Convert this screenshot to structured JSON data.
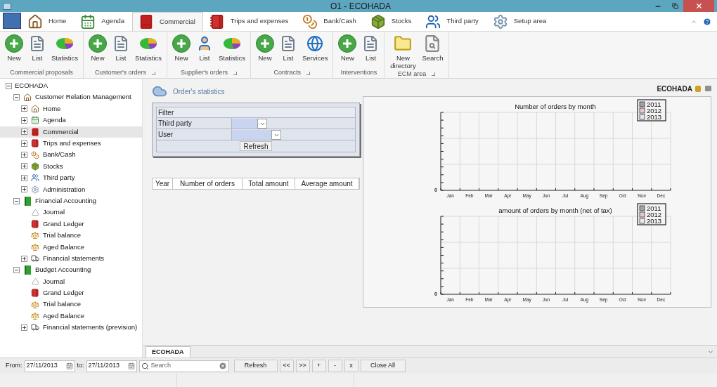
{
  "window": {
    "title": "O1 - ECOHADA"
  },
  "tabs": [
    {
      "label": "Home",
      "kind": "house",
      "selected": false
    },
    {
      "label": "Agenda",
      "kind": "calendar",
      "selected": false
    },
    {
      "label": "Commercial",
      "kind": "book",
      "selected": true
    },
    {
      "label": "Trips and expenses",
      "kind": "ledger",
      "selected": false
    },
    {
      "label": "Bank/Cash",
      "kind": "bag",
      "selected": false
    },
    {
      "label": "Stocks",
      "kind": "box",
      "selected": false
    },
    {
      "label": "Third party",
      "kind": "people",
      "selected": false
    },
    {
      "label": "Setup area",
      "kind": "gear",
      "selected": false
    }
  ],
  "ribbon_groups": [
    {
      "label": "Commercial proposals",
      "launcher": false,
      "buttons": [
        {
          "label": "New",
          "kind": "new"
        },
        {
          "label": "List",
          "kind": "list"
        },
        {
          "label": "Statistics",
          "kind": "stats"
        }
      ]
    },
    {
      "label": "Customer's orders",
      "launcher": true,
      "buttons": [
        {
          "label": "New",
          "kind": "new"
        },
        {
          "label": "List",
          "kind": "list"
        },
        {
          "label": "Statistics",
          "kind": "stats"
        }
      ]
    },
    {
      "label": "Supplier's orders",
      "launcher": true,
      "buttons": [
        {
          "label": "New",
          "kind": "new"
        },
        {
          "label": "List",
          "kind": "person"
        },
        {
          "label": "Statistics",
          "kind": "stats"
        }
      ]
    },
    {
      "label": "Contracts",
      "launcher": true,
      "buttons": [
        {
          "label": "New",
          "kind": "new"
        },
        {
          "label": "List",
          "kind": "list"
        },
        {
          "label": "Services",
          "kind": "globe"
        }
      ]
    },
    {
      "label": "Interventions",
      "launcher": false,
      "buttons": [
        {
          "label": "New",
          "kind": "new"
        },
        {
          "label": "List",
          "kind": "list"
        }
      ]
    },
    {
      "label": "ECM area",
      "launcher": true,
      "buttons": [
        {
          "label": "New directory",
          "kind": "folder"
        },
        {
          "label": "Search",
          "kind": "search"
        }
      ]
    }
  ],
  "sidebar": {
    "tree": [
      {
        "label": "ECOHADA",
        "expanded": true,
        "selected": false,
        "children": [
          {
            "label": "Customer Relation Management",
            "kind": "house",
            "expanded": true,
            "selected": false,
            "children": [
              {
                "label": "Home",
                "kind": "house",
                "expanded": false,
                "selected": false
              },
              {
                "label": "Agenda",
                "kind": "calendar",
                "expanded": false,
                "selected": false
              },
              {
                "label": "Commercial",
                "kind": "book",
                "expanded": false,
                "selected": true
              },
              {
                "label": "Trips and expenses",
                "kind": "ledger",
                "expanded": false,
                "selected": false
              },
              {
                "label": "Bank/Cash",
                "kind": "bag",
                "expanded": false,
                "selected": false
              },
              {
                "label": "Stocks",
                "kind": "box",
                "expanded": false,
                "selected": false
              },
              {
                "label": "Third party",
                "kind": "people",
                "expanded": false,
                "selected": false
              },
              {
                "label": "Administration",
                "kind": "gear",
                "expanded": false,
                "selected": false
              }
            ]
          },
          {
            "label": "Financial Accounting",
            "kind": "green",
            "expanded": true,
            "selected": false,
            "children": [
              {
                "label": "Journal",
                "kind": "triangle",
                "selected": false
              },
              {
                "label": "Grand Ledger",
                "kind": "ledger",
                "selected": false
              },
              {
                "label": "Trial balance",
                "kind": "scales",
                "selected": false
              },
              {
                "label": "Aged Balance",
                "kind": "scales",
                "selected": false
              },
              {
                "label": "Financial statements",
                "kind": "truck",
                "expanded": false,
                "selected": false
              }
            ]
          },
          {
            "label": "Budget Accounting",
            "kind": "green",
            "expanded": true,
            "selected": false,
            "children": [
              {
                "label": "Journal",
                "kind": "triangle",
                "selected": false
              },
              {
                "label": "Grand Ledger",
                "kind": "ledger",
                "selected": false
              },
              {
                "label": "Trial balance",
                "kind": "scales",
                "selected": false
              },
              {
                "label": "Aged Balance",
                "kind": "scales",
                "selected": false
              },
              {
                "label": "Financial statements (prevision)",
                "kind": "truck",
                "expanded": false,
                "selected": false
              }
            ]
          }
        ]
      }
    ]
  },
  "content": {
    "title": "Order's statistics",
    "company": "ECOHADA",
    "filter": {
      "heading": "Filter",
      "fields": [
        {
          "label": "Third party"
        },
        {
          "label": "User"
        }
      ],
      "button": "Refresh"
    },
    "table": {
      "columns": [
        "Year",
        "Number of orders",
        "Total amount",
        "Average amount"
      ]
    },
    "charts": [
      {
        "title": "Number of orders by month",
        "ytick": "0",
        "months": [
          "Jan",
          "Feb",
          "Mar",
          "Apr",
          "May",
          "Jun",
          "Jul",
          "Aug",
          "Sep",
          "Oct",
          "Nov",
          "Dec"
        ],
        "legend": [
          {
            "label": "2011",
            "color": "#a0a0a8"
          },
          {
            "label": "2012",
            "color": "#e8c8d0"
          },
          {
            "label": "2013",
            "color": "#e4e4f4"
          }
        ]
      },
      {
        "title": "amount of orders by month (net of tax)",
        "ytick": "0",
        "months": [
          "Jan",
          "Feb",
          "Mar",
          "Apr",
          "May",
          "Jun",
          "Jul",
          "Aug",
          "Sep",
          "Oct",
          "Nov",
          "Dec"
        ],
        "legend": [
          {
            "label": "2011",
            "color": "#a0a8a8"
          },
          {
            "label": "2012",
            "color": "#e8c8d0"
          },
          {
            "label": "2013",
            "color": "#e8e8f0"
          }
        ]
      }
    ]
  },
  "doc_tabs": [
    {
      "label": "ECOHADA",
      "selected": true
    }
  ],
  "toolbar": {
    "from_label": "From:",
    "from_value": "27/11/2013",
    "to_label": "to:",
    "to_value": "27/11/2013",
    "search_placeholder": "Search",
    "buttons": [
      "Refresh",
      "<<",
      ">>",
      "+",
      "-",
      "x",
      "Close All"
    ]
  }
}
